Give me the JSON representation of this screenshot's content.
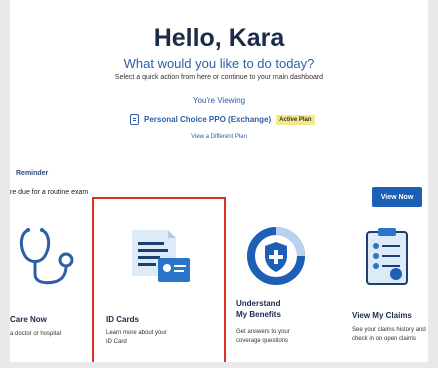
{
  "greeting": "Hello, Kara",
  "subheading": "What would you like to do today?",
  "instruction": "Select a quick action from here or continue to your main dashboard",
  "viewing_label": "You're Viewing",
  "plan": {
    "name": "Personal Choice PPO (Exchange)",
    "badge": "Active Plan",
    "switch_link": "View a Different Plan"
  },
  "reminder": {
    "label": "Reminder",
    "text": "re due for a routine exam",
    "button": "View Now"
  },
  "cards": [
    {
      "title": "Care Now",
      "desc": "a doctor or hospital",
      "icon": "stethoscope-icon"
    },
    {
      "title": "ID Cards",
      "desc_lines": [
        "Learn more about your",
        "ID Card"
      ],
      "icon": "id-card-icon"
    },
    {
      "title_lines": [
        "Understand",
        "My Benefits"
      ],
      "desc_lines": [
        "Get answers to your",
        "coverage questions"
      ],
      "icon": "shield-benefits-icon"
    },
    {
      "title": "View My Claims",
      "desc_lines": [
        "See your claims history and",
        "check in on open claims"
      ],
      "icon": "clipboard-claims-icon"
    }
  ],
  "colors": {
    "accent": "#1d5fb5",
    "highlight_outline": "#d93323",
    "title": "#1c2b4a"
  }
}
